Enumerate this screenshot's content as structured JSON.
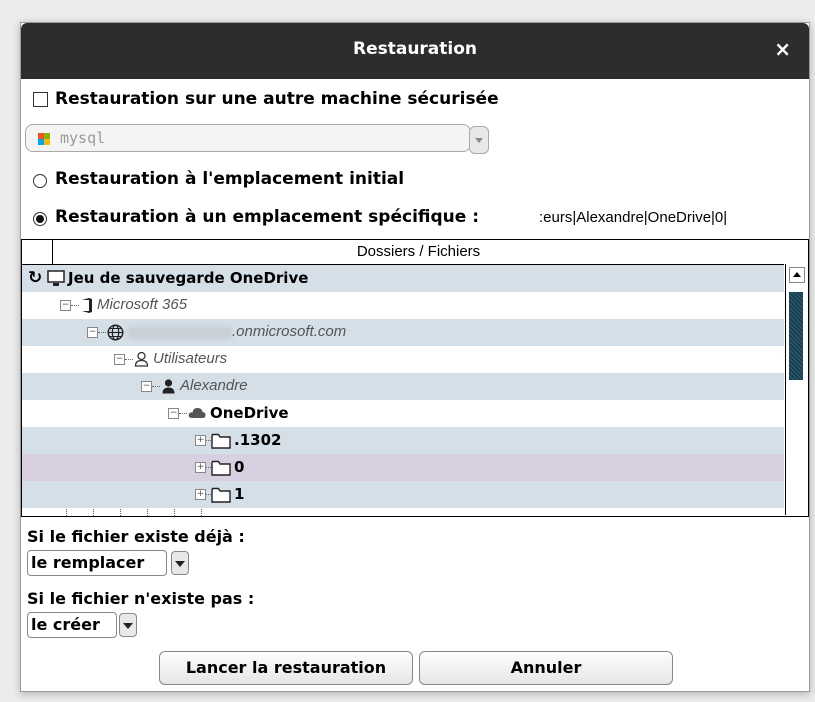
{
  "dialog": {
    "title": "Restauration",
    "close_label": "×"
  },
  "options": {
    "other_machine_label": "Restauration sur une autre machine sécurisée",
    "machine_select_value": "mysql",
    "initial_location_label": "Restauration à l'emplacement initial",
    "specific_location_label": "Restauration à un emplacement spécifique :",
    "specific_location_path": ":eurs|Alexandre|OneDrive|0|"
  },
  "tree": {
    "column_header": "Dossiers / Fichiers",
    "rows": [
      {
        "label": "Jeu de sauvegarde OneDrive",
        "icon": "computer-icon",
        "bg": "#d4dfe8"
      },
      {
        "label": "Microsoft 365",
        "icon": "office-icon",
        "bg": "#ffffff"
      },
      {
        "label": ".onmicrosoft.com",
        "icon": "globe-icon",
        "bg": "#d4dfe8"
      },
      {
        "label": "Utilisateurs",
        "icon": "users-icon",
        "bg": "#ffffff"
      },
      {
        "label": "Alexandre",
        "icon": "user-icon",
        "bg": "#d4dfe8"
      },
      {
        "label": "OneDrive",
        "icon": "cloud-icon",
        "bg": "#ffffff"
      },
      {
        "label": ".1302",
        "icon": "folder-icon",
        "bg": "#d4dfe8"
      },
      {
        "label": "0",
        "icon": "folder-icon",
        "bg": "#d8cfe0"
      },
      {
        "label": "1",
        "icon": "folder-icon",
        "bg": "#d4dfe8"
      }
    ]
  },
  "existing_file": {
    "label": "Si le fichier existe déjà :",
    "value": "le remplacer"
  },
  "missing_file": {
    "label": "Si le fichier n'existe pas :",
    "value": "le créer"
  },
  "buttons": {
    "start": "Lancer la restauration",
    "cancel": "Annuler"
  }
}
